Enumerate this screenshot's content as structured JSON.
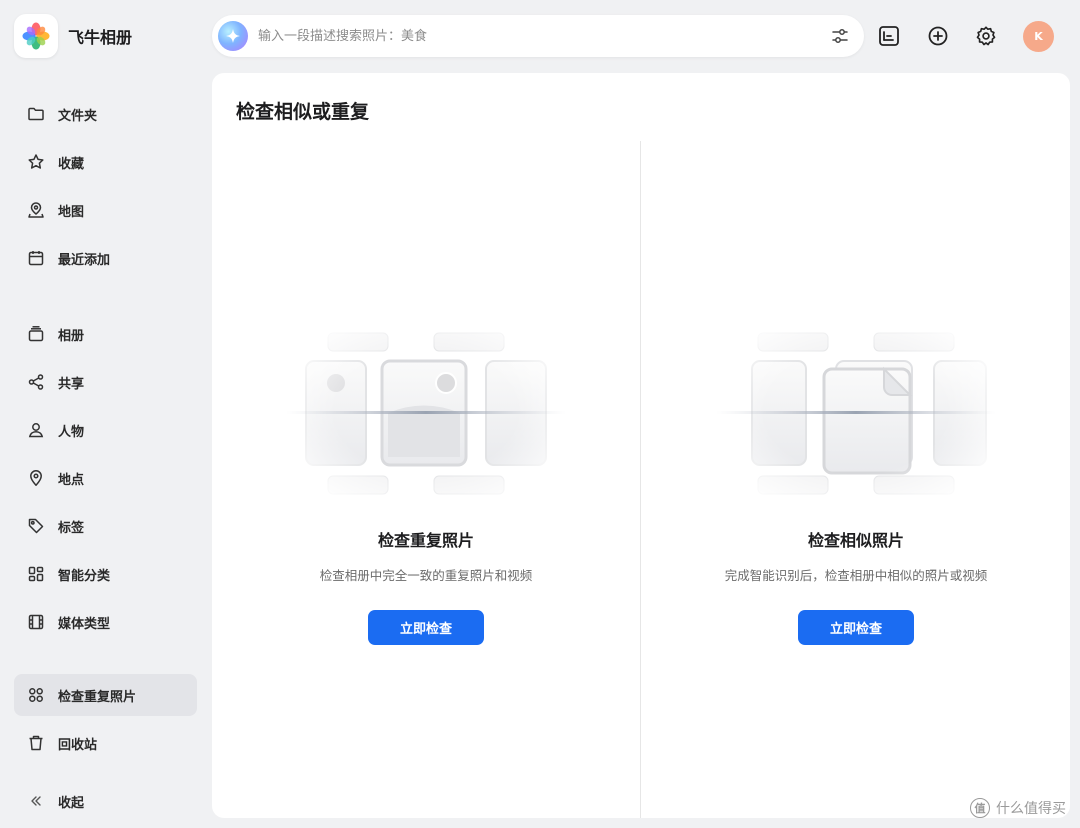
{
  "app": {
    "title": "飞牛相册"
  },
  "search": {
    "placeholder": "输入一段描述搜索照片：美食"
  },
  "header": {
    "avatar_initial": "K"
  },
  "sidebar": {
    "items": [
      {
        "label": "文件夹",
        "icon": "folder-icon"
      },
      {
        "label": "收藏",
        "icon": "star-icon"
      },
      {
        "label": "地图",
        "icon": "map-icon"
      },
      {
        "label": "最近添加",
        "icon": "calendar-icon"
      },
      {
        "label": "相册",
        "icon": "album-icon"
      },
      {
        "label": "共享",
        "icon": "share-icon"
      },
      {
        "label": "人物",
        "icon": "person-icon"
      },
      {
        "label": "地点",
        "icon": "location-pin-icon"
      },
      {
        "label": "标签",
        "icon": "tag-icon"
      },
      {
        "label": "智能分类",
        "icon": "grid-icon"
      },
      {
        "label": "媒体类型",
        "icon": "film-icon"
      },
      {
        "label": "检查重复照片",
        "icon": "duplicate-check-icon",
        "active": true
      },
      {
        "label": "回收站",
        "icon": "trash-icon"
      }
    ],
    "collapse_label": "收起"
  },
  "main": {
    "title": "检查相似或重复",
    "cards": [
      {
        "title": "检查重复照片",
        "description": "检查相册中完全一致的重复照片和视频",
        "button": "立即检查"
      },
      {
        "title": "检查相似照片",
        "description": "完成智能识别后，检查相册中相似的照片或视频",
        "button": "立即检查"
      }
    ]
  },
  "watermark": {
    "text": "什么值得买",
    "mark": "值"
  },
  "colors": {
    "accent": "#1b6cf2",
    "background": "#f0f1f3",
    "avatar": "#f6a98a"
  }
}
